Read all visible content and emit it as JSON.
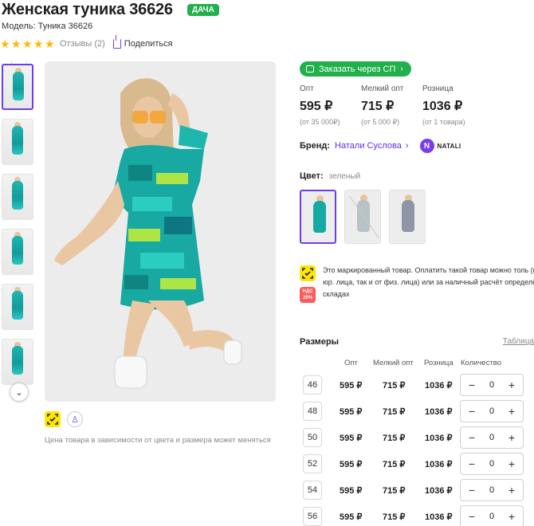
{
  "product": {
    "title": "Женская туника 36626",
    "badge": "ДАЧА",
    "model": "Модель: Туника 36626",
    "reviews": "Отзывы (2)",
    "share": "Поделиться",
    "rating": 5
  },
  "gallery": {
    "price_note": "Цена товара в зависимости от цвета и размера может меняться"
  },
  "order_button": "Заказать через СП",
  "prices": [
    {
      "label": "Опт",
      "value": "595 ₽",
      "sub": "(от 35 000₽)"
    },
    {
      "label": "Мелкий опт",
      "value": "715 ₽",
      "sub": "(от 5 000 ₽)"
    },
    {
      "label": "Розница",
      "value": "1036 ₽",
      "sub": "(от 1 товара)"
    }
  ],
  "brand": {
    "label": "Бренд:",
    "name": "Натали Суслова",
    "logo_text": "NATALI",
    "logo_letter": "N"
  },
  "color": {
    "label": "Цвет:",
    "value": "зеленый"
  },
  "marking_note": "Это маркированный товар. Оплатить такой товар можно толь (как от юр. лица, так и от физ. лица) или за наличный расчёт определённых складах",
  "vat": {
    "line1": "НДС",
    "line2": "20%"
  },
  "sizes": {
    "title": "Размеры",
    "table_link": "Таблица",
    "columns": [
      "Опт",
      "Мелкий опт",
      "Розница",
      "Количество"
    ],
    "rows": [
      {
        "size": "46",
        "opt": "595 ₽",
        "small": "715 ₽",
        "retail": "1036 ₽",
        "qty": "0"
      },
      {
        "size": "48",
        "opt": "595 ₽",
        "small": "715 ₽",
        "retail": "1036 ₽",
        "qty": "0"
      },
      {
        "size": "50",
        "opt": "595 ₽",
        "small": "715 ₽",
        "retail": "1036 ₽",
        "qty": "0"
      },
      {
        "size": "52",
        "opt": "595 ₽",
        "small": "715 ₽",
        "retail": "1036 ₽",
        "qty": "0"
      },
      {
        "size": "54",
        "opt": "595 ₽",
        "small": "715 ₽",
        "retail": "1036 ₽",
        "qty": "0"
      },
      {
        "size": "56",
        "opt": "595 ₽",
        "small": "715 ₽",
        "retail": "1036 ₽",
        "qty": "0"
      }
    ],
    "minus": "−",
    "plus": "+"
  },
  "colors": {
    "accent": "#21b04b",
    "brand": "#6b3df0",
    "star": "#ffb800",
    "vat": "#ff5a5a",
    "mark": "#ffe600"
  }
}
